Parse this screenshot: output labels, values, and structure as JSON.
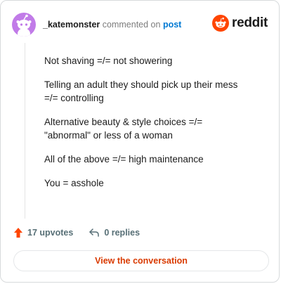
{
  "header": {
    "username": "_katemonster",
    "action_text": "commented on",
    "target": "post",
    "brand": "reddit"
  },
  "comment": {
    "paragraphs": [
      "Not shaving =/= not showering",
      "Telling an adult they should pick up their mess\n=/= controlling",
      "Alternative beauty & style choices =/=\n\"abnormal\" or less of a woman",
      "All of the above =/= high maintenance",
      "You = asshole"
    ]
  },
  "actions": {
    "upvotes": "17 upvotes",
    "replies": "0 replies"
  },
  "footer": {
    "view_label": "View the conversation"
  },
  "colors": {
    "brand": "#ff4500",
    "link": "#0079d3",
    "avatar": "#c17be8",
    "view_text": "#d93a00"
  },
  "icons": [
    "snoo-avatar-icon",
    "reddit-logo-icon",
    "upvote-arrow-icon",
    "reply-arrow-icon"
  ]
}
